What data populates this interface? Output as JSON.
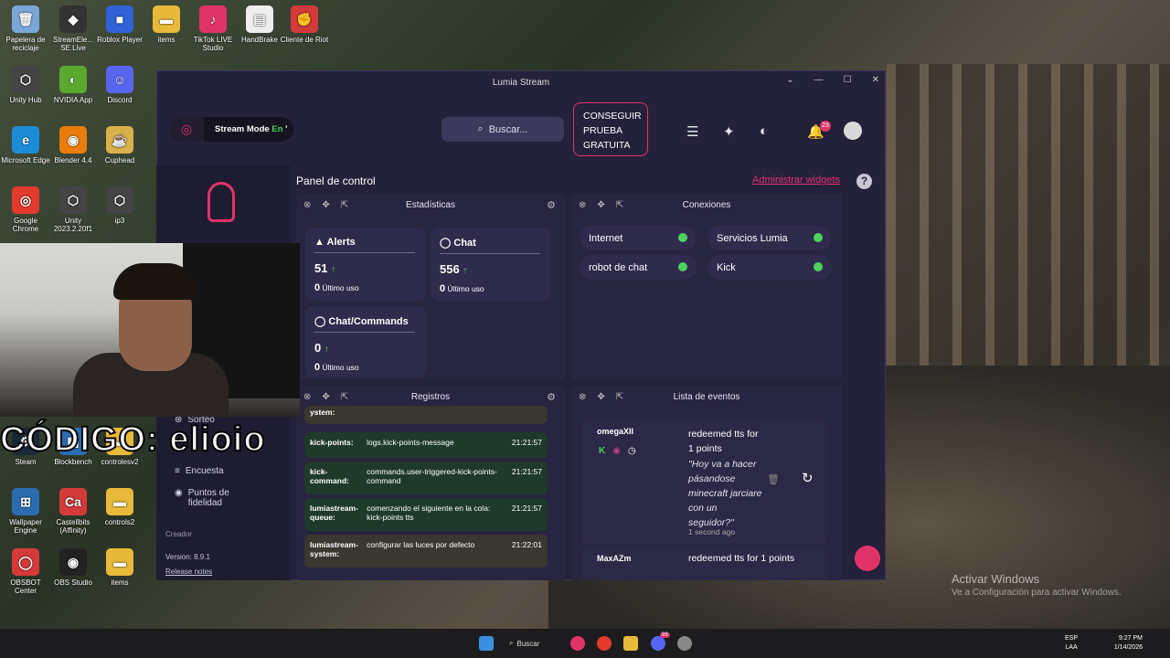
{
  "desktop": {
    "icons": [
      {
        "label": "Papelera de reciclaje",
        "color": "#7aa7d8",
        "glyph": "🗑"
      },
      {
        "label": "StreamEle... SE.Live",
        "color": "#333",
        "glyph": "◆"
      },
      {
        "label": "Roblox Player",
        "color": "#2f62d6",
        "glyph": "■"
      },
      {
        "label": "items",
        "color": "#e8b93a",
        "glyph": "▬"
      },
      {
        "label": "TikTok LIVE Studio",
        "color": "#e0336a",
        "glyph": "♪"
      },
      {
        "label": "HandBrake",
        "color": "#eee",
        "glyph": "▤"
      },
      {
        "label": "Cliente de Riot",
        "color": "#d43a3a",
        "glyph": "✊"
      },
      {
        "label": "Unity Hub",
        "color": "#444",
        "glyph": "⬡"
      },
      {
        "label": "NVIDIA App",
        "color": "#5aa82e",
        "glyph": "◐"
      },
      {
        "label": "Discord",
        "color": "#5865f2",
        "glyph": "☺"
      },
      {
        "label": "Microsoft Edge",
        "color": "#1d8cd6",
        "glyph": "e"
      },
      {
        "label": "Blender 4.4",
        "color": "#e87d0d",
        "glyph": "◉"
      },
      {
        "label": "Cuphead",
        "color": "#d9b14a",
        "glyph": "☕"
      },
      {
        "label": "Google Chrome",
        "color": "#e23b2e",
        "glyph": "◎"
      },
      {
        "label": "Unity 2023.2.20f1",
        "color": "#444",
        "glyph": "⬡"
      },
      {
        "label": "ip3",
        "color": "#444",
        "glyph": "⬡"
      },
      {
        "label": "Steam",
        "color": "#1b2838",
        "glyph": "⚙"
      },
      {
        "label": "Blockbench",
        "color": "#2b6cb0",
        "glyph": "▦"
      },
      {
        "label": "controlesv2",
        "color": "#e8b93a",
        "glyph": "▬"
      },
      {
        "label": "Wallpaper Engine",
        "color": "#2b6cb0",
        "glyph": "⊞"
      },
      {
        "label": "Castellbits (Affinity)",
        "color": "#d43a3a",
        "glyph": "Ca"
      },
      {
        "label": "controls2",
        "color": "#e8b93a",
        "glyph": "▬"
      },
      {
        "label": "OBSBOT Center",
        "color": "#d43a3a",
        "glyph": "◯"
      },
      {
        "label": "OBS Studio",
        "color": "#222",
        "glyph": "◉"
      },
      {
        "label": "items",
        "color": "#e8b93a",
        "glyph": "▬"
      }
    ],
    "watermark_title": "Activar Windows",
    "watermark_sub": "Ve a Configuración para activar Windows."
  },
  "overlay": {
    "code_text": "CÓDIGO: elioio"
  },
  "app": {
    "title": "Lumia Stream",
    "window_controls": [
      "⌄",
      "—",
      "☐",
      "✕"
    ],
    "stream_mode": {
      "label": "Stream Mode",
      "state": "En",
      "suffix": " '"
    },
    "search_placeholder": "Buscar...",
    "trial_button": "CONSEGUIR PRUEBA GRATUITA",
    "notif_count": "23",
    "panel_title": "Panel de control",
    "manage_widgets": "Administrar widgets",
    "help": "?",
    "sidebar": {
      "items": [
        {
          "label": "Sorteo"
        },
        {
          "label": "Encuesta"
        },
        {
          "label": "Puntos de fidelidad"
        }
      ],
      "creator": "Creador",
      "version": "Version: 8.9.1",
      "release_notes": "Release notes"
    },
    "stats": {
      "title": "Estadísticas",
      "cards": [
        {
          "name": "Alerts",
          "value": "51",
          "last": "0",
          "last_label": "Último uso"
        },
        {
          "name": "Chat",
          "value": "556",
          "last": "0",
          "last_label": "Último uso"
        },
        {
          "name": "Chat/Commands",
          "value": "0",
          "last": "0",
          "last_label": "Último uso"
        }
      ]
    },
    "connections": {
      "title": "Conexiones",
      "items": [
        {
          "name": "Internet"
        },
        {
          "name": "Servicios Lumia"
        },
        {
          "name": "robot de chat"
        },
        {
          "name": "Kick"
        }
      ]
    },
    "logs": {
      "title": "Registros",
      "rows": [
        {
          "source": "ystem:",
          "message": "",
          "time": ""
        },
        {
          "source": "kick-points:",
          "message": "logs.kick-points-message",
          "time": "21:21:57"
        },
        {
          "source": "kick-command:",
          "message": "commands.user-triggered-kick-points-command",
          "time": "21:21:57"
        },
        {
          "source": "lumiastream-queue:",
          "message": "comenzando el siguiente en la cola: kick-points tts",
          "time": "21:21:57"
        },
        {
          "source": "lumiastream-system:",
          "message": "configurar las luces por defecto",
          "time": "21:22:01"
        }
      ]
    },
    "events": {
      "title": "Lista de eventos",
      "items": [
        {
          "user": "omegaXII",
          "action": "redeemed tts for 1 points",
          "quote": "\"Hoy va a hacer pásandose minecraft jarciare con un seguidor?\"",
          "ago": "1 second ago"
        },
        {
          "user": "MaxAZm",
          "action": "redeemed tts for 1 points",
          "quote": "",
          "ago": ""
        }
      ]
    }
  },
  "taskbar": {
    "search": "Buscar",
    "discord_badge": "99",
    "lang": "ESP",
    "lang2": "LAA",
    "time": "9:27 PM",
    "date": "1/14/2026"
  }
}
